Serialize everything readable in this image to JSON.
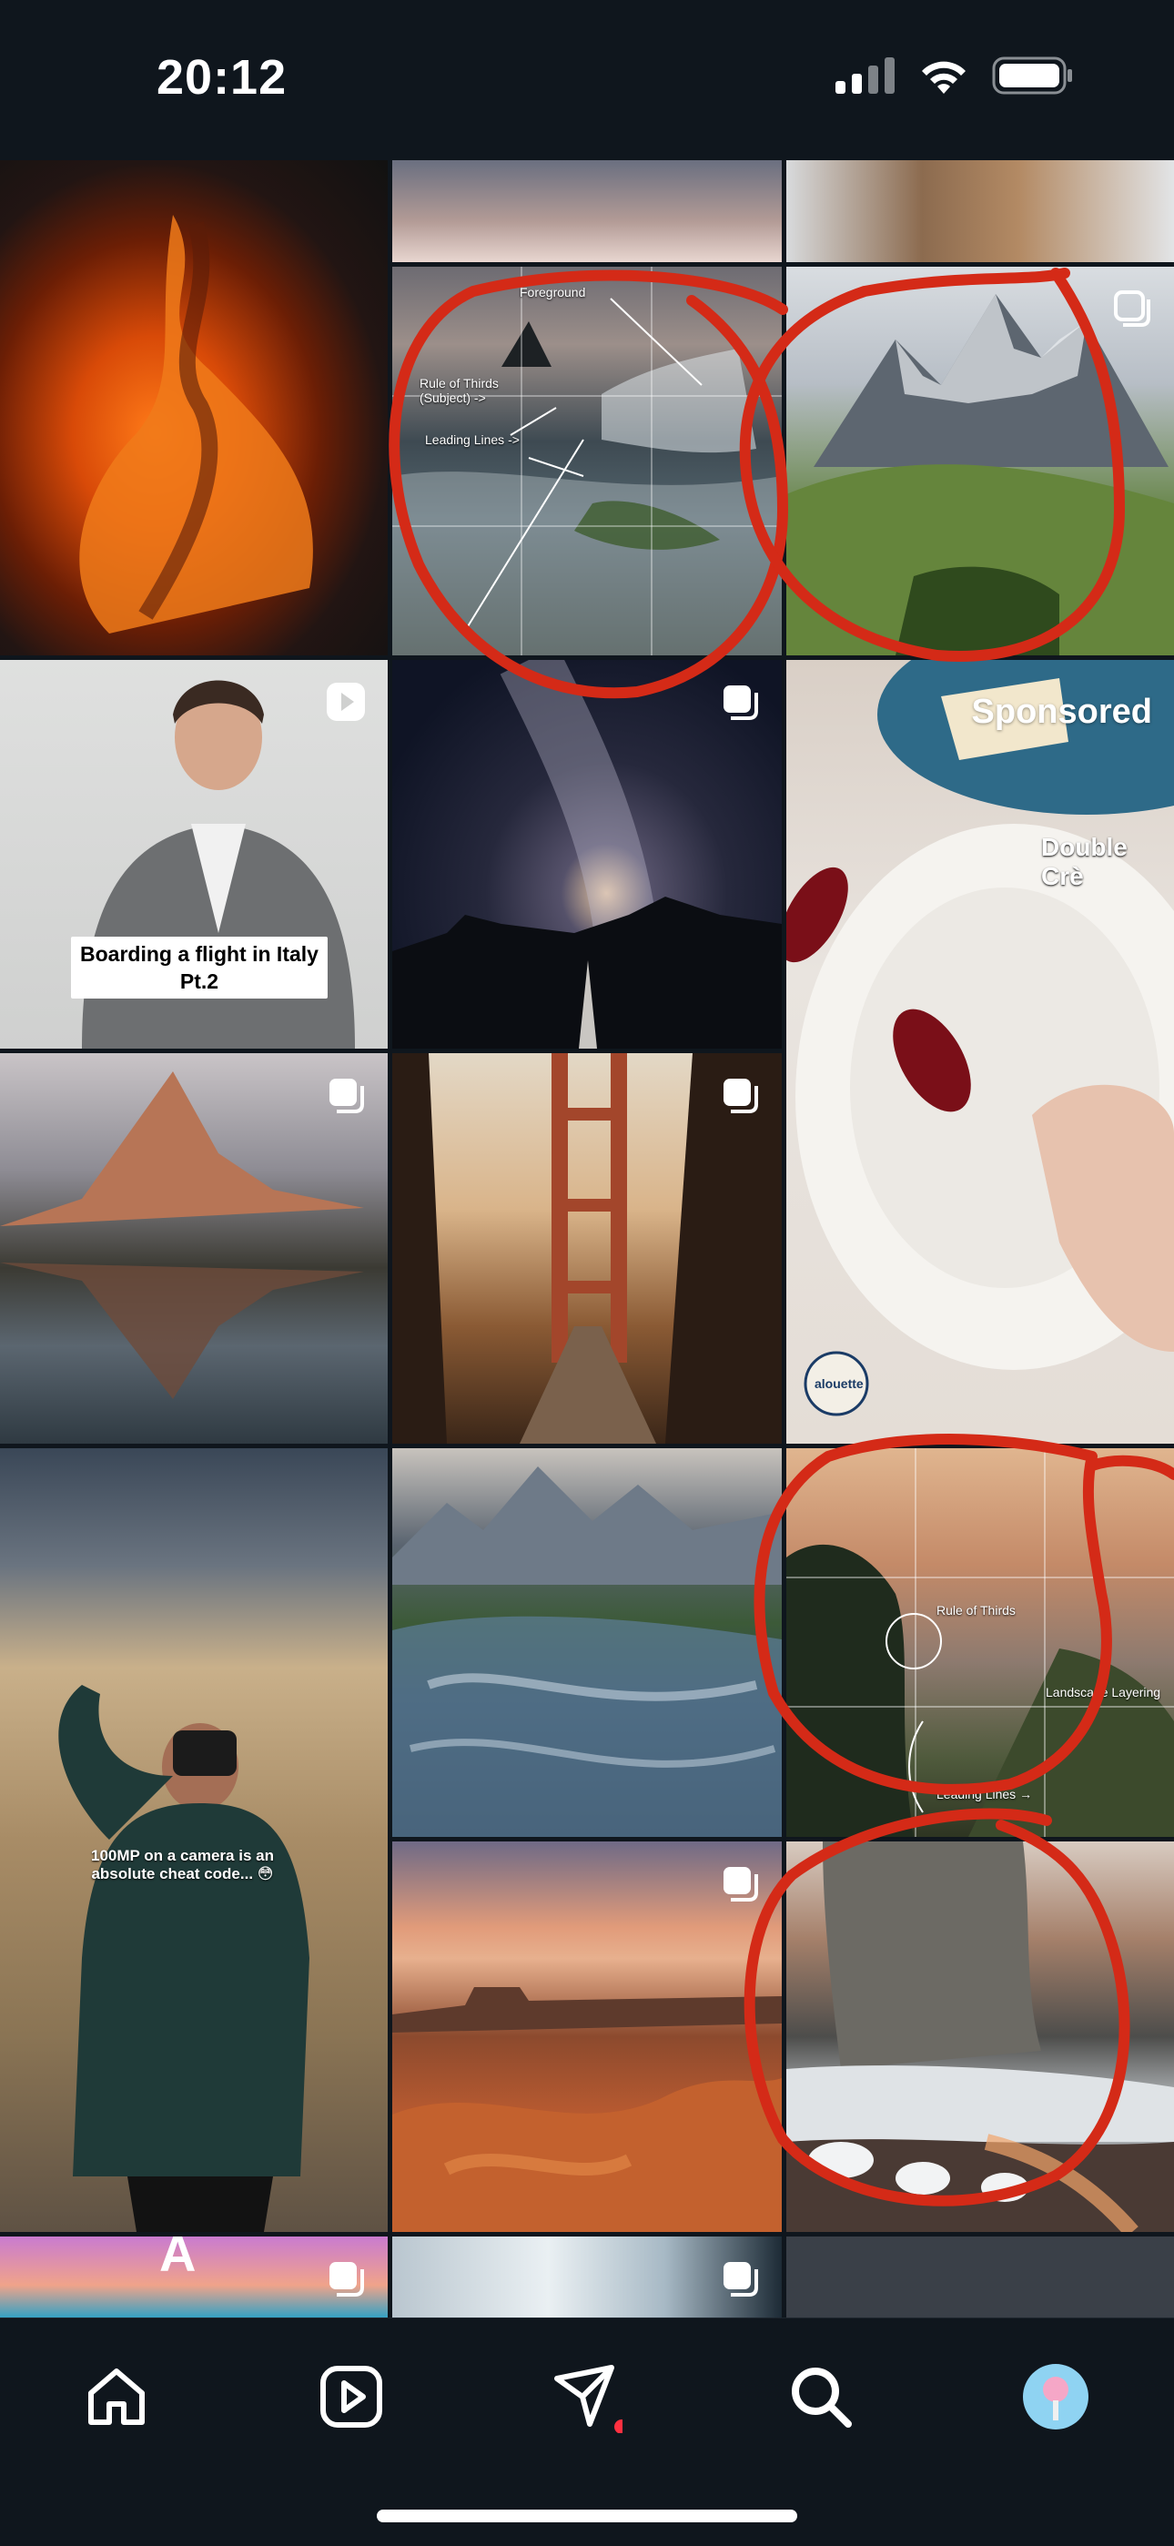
{
  "status_bar": {
    "time": "20:12",
    "icons": [
      "cellular-signal-icon",
      "wifi-icon",
      "battery-icon"
    ]
  },
  "explore_grid": {
    "posts": [
      {
        "id": "lava",
        "type": "image",
        "description": "lava-flow-photo"
      },
      {
        "id": "rule-of-thirds-seascape",
        "type": "carousel",
        "labels": {
          "foreground": "Foreground",
          "rule_of_thirds": "Rule of Thirds\n(Subject) ->",
          "leading_lines": "Leading Lines ->"
        }
      },
      {
        "id": "mountain-peaks",
        "type": "carousel"
      },
      {
        "id": "flight-reel",
        "type": "reel",
        "caption": "Boarding a flight in Italy\nPt.2"
      },
      {
        "id": "milky-way",
        "type": "carousel"
      },
      {
        "id": "sponsored-cheese",
        "type": "ad",
        "sponsored_label": "Sponsored",
        "brand_text": "alouette",
        "product_text": "Double Crè"
      },
      {
        "id": "mountain-reflection",
        "type": "carousel"
      },
      {
        "id": "golden-gate",
        "type": "carousel"
      },
      {
        "id": "photographer-reel",
        "type": "reel",
        "caption": "100MP on a camera is an\nabsolute cheat code... 😳"
      },
      {
        "id": "waterfall-river",
        "type": "image"
      },
      {
        "id": "forest-composition",
        "type": "image",
        "labels": {
          "rule_of_thirds": "Rule of Thirds",
          "layering": "Landscape Layering",
          "leading_lines": "Leading Lines →"
        }
      },
      {
        "id": "desert-canyon",
        "type": "carousel"
      },
      {
        "id": "snowy-cliff",
        "type": "image"
      },
      {
        "id": "sunset-partial",
        "type": "carousel",
        "text": "A"
      },
      {
        "id": "ice-cave-partial",
        "type": "carousel"
      }
    ]
  },
  "bottom_nav": {
    "items": [
      "home-icon",
      "reels-icon",
      "messages-icon",
      "search-icon",
      "profile-avatar"
    ],
    "accent": "#ff3040"
  },
  "colors": {
    "background": "#0f161d",
    "annotation_red": "#d42a17"
  }
}
